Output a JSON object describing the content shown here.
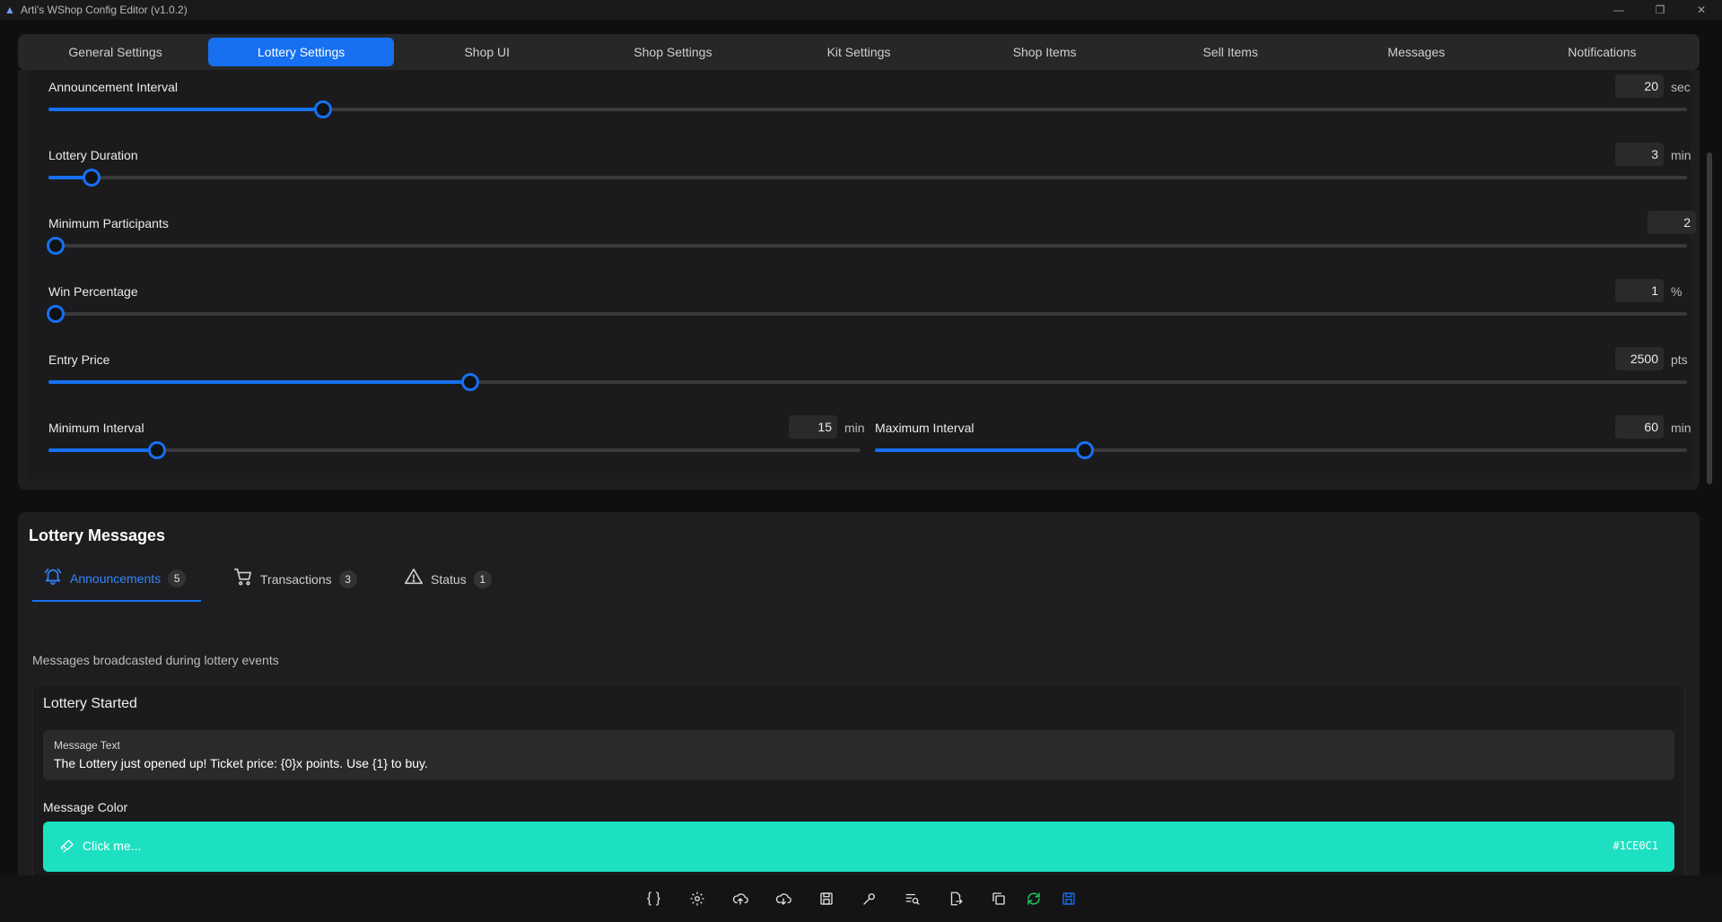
{
  "app": {
    "title": "Arti's WShop Config Editor (v1.0.2)"
  },
  "window_controls": {
    "minimize": "—",
    "restore": "❐",
    "close": "✕"
  },
  "tabs": [
    {
      "label": "General Settings",
      "active": false
    },
    {
      "label": "Lottery Settings",
      "active": true
    },
    {
      "label": "Shop UI",
      "active": false
    },
    {
      "label": "Shop Settings",
      "active": false
    },
    {
      "label": "Kit Settings",
      "active": false
    },
    {
      "label": "Shop Items",
      "active": false
    },
    {
      "label": "Sell Items",
      "active": false
    },
    {
      "label": "Messages",
      "active": false
    },
    {
      "label": "Notifications",
      "active": false
    }
  ],
  "sliders": {
    "announcement_interval": {
      "label": "Announcement Interval",
      "value": "20",
      "unit": "sec",
      "fraction": 0.163
    },
    "lottery_duration": {
      "label": "Lottery Duration",
      "value": "3",
      "unit": "min",
      "fraction": 0.022
    },
    "minimum_participants": {
      "label": "Minimum Participants",
      "value": "2",
      "unit": "",
      "fraction": 0.0
    },
    "win_percentage": {
      "label": "Win Percentage",
      "value": "1",
      "unit": "%",
      "fraction": 0.0
    },
    "entry_price": {
      "label": "Entry Price",
      "value": "2500",
      "unit": "pts",
      "fraction": 0.253
    },
    "minimum_interval": {
      "label": "Minimum Interval",
      "value": "15",
      "unit": "min",
      "fraction": 0.125
    },
    "maximum_interval": {
      "label": "Maximum Interval",
      "value": "60",
      "unit": "min",
      "fraction": 0.25
    }
  },
  "lottery_messages": {
    "title": "Lottery Messages",
    "subtabs": [
      {
        "label": "Announcements",
        "count": "5",
        "icon": "bell-icon",
        "active": true
      },
      {
        "label": "Transactions",
        "count": "3",
        "icon": "cart-icon",
        "active": false
      },
      {
        "label": "Status",
        "count": "1",
        "icon": "warning-icon",
        "active": false
      }
    ],
    "description": "Messages broadcasted during lottery events",
    "card": {
      "title": "Lottery Started",
      "message_label": "Message Text",
      "message_text": "The Lottery just opened up! Ticket price: {0}x points. Use {1} to buy.",
      "color_label": "Message Color",
      "color_button": "Click me...",
      "color_hex": "#1CE0C1",
      "color_value": "#1ce0c1"
    }
  },
  "toolbar": {
    "buttons": [
      "json-icon",
      "gear-icon",
      "upload-cloud-icon",
      "download-cloud-icon",
      "save-file-icon",
      "wrench-icon",
      "search-list-icon",
      "export-file-icon",
      "copy-icon",
      "refresh-icon",
      "save-icon"
    ],
    "json_glyph": "{ }"
  },
  "colors": {
    "accent": "#1670f0",
    "success": "#22c55e"
  }
}
